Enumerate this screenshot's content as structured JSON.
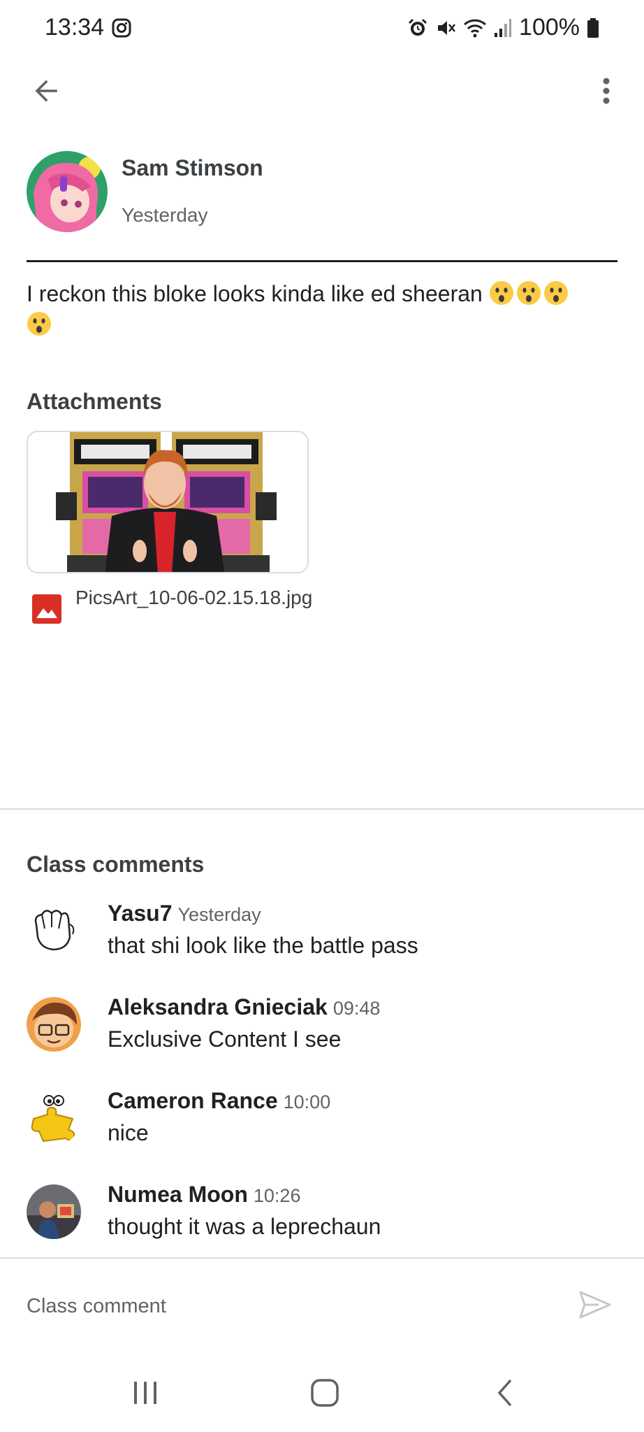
{
  "status_bar": {
    "time": "13:34",
    "battery": "100%"
  },
  "app_bar": {
    "back_icon": "arrow-left-icon",
    "menu_icon": "more-vert-icon"
  },
  "post": {
    "author": "Sam Stimson",
    "time": "Yesterday",
    "text": "I reckon this bloke looks kinda like ed sheeran",
    "emoji_count": 4,
    "attachments_title": "Attachments",
    "attachment": {
      "file_name": "PicsArt_10-06-02.15.18.jpg",
      "icon": "image-file-icon"
    }
  },
  "comments": {
    "title": "Class comments",
    "items": [
      {
        "author": "Yasu7",
        "time": "Yesterday",
        "text": "that shi look like the battle pass"
      },
      {
        "author": "Aleksandra Gnieciak",
        "time": "09:48",
        "text": "Exclusive Content I see"
      },
      {
        "author": "Cameron Rance",
        "time": "10:00",
        "text": "nice"
      },
      {
        "author": "Numea Moon",
        "time": "10:26",
        "text": "thought it was a leprechaun"
      }
    ]
  },
  "composer": {
    "placeholder": "Class comment",
    "send_icon": "send-icon"
  },
  "colors": {
    "text_primary": "#202124",
    "text_secondary": "#5f6368",
    "divider": "#dadce0",
    "file_icon_red": "#d93025"
  }
}
